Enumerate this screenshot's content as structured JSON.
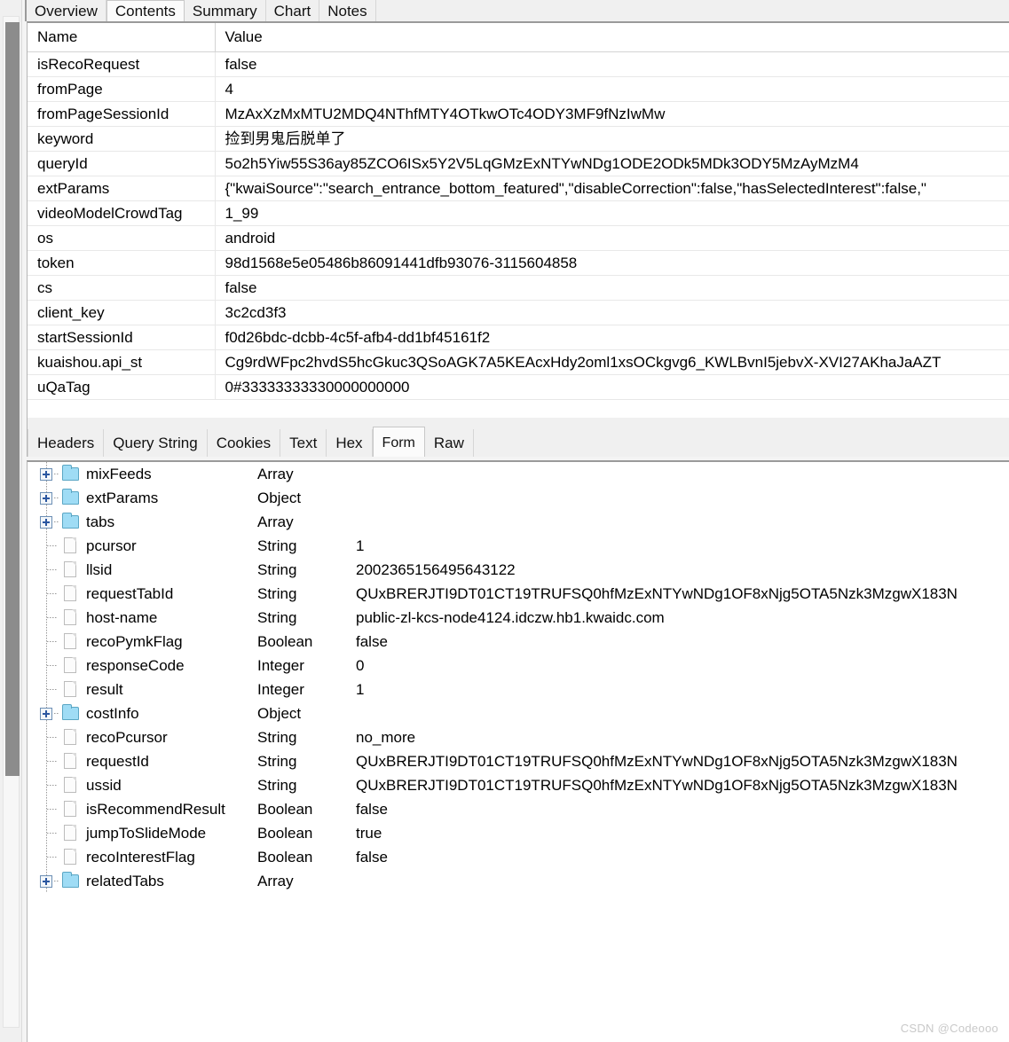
{
  "window": {
    "watermark": "CSDN @Codeooo"
  },
  "top_tabs": {
    "items": [
      {
        "label": "Overview",
        "active": false
      },
      {
        "label": "Contents",
        "active": true
      },
      {
        "label": "Summary",
        "active": false
      },
      {
        "label": "Chart",
        "active": false
      },
      {
        "label": "Notes",
        "active": false
      }
    ]
  },
  "params_table": {
    "columns": [
      "Name",
      "Value"
    ],
    "rows": [
      {
        "name": "isRecoRequest",
        "value": "false"
      },
      {
        "name": "fromPage",
        "value": "4"
      },
      {
        "name": "fromPageSessionId",
        "value": "MzAxXzMxMTU2MDQ4NThfMTY4OTkwOTc4ODY3MF9fNzIwMw"
      },
      {
        "name": "keyword",
        "value": "捡到男鬼后脱单了"
      },
      {
        "name": "queryId",
        "value": "5o2h5Yiw55S36ay85ZCO6ISx5Y2V5LqGMzExNTYwNDg1ODE2ODk5MDk3ODY5MzAyMzM4"
      },
      {
        "name": "extParams",
        "value": "{\"kwaiSource\":\"search_entrance_bottom_featured\",\"disableCorrection\":false,\"hasSelectedInterest\":false,\""
      },
      {
        "name": "videoModelCrowdTag",
        "value": "1_99"
      },
      {
        "name": "os",
        "value": "android"
      },
      {
        "name": "token",
        "value": "98d1568e5e05486b86091441dfb93076-3115604858"
      },
      {
        "name": "cs",
        "value": "false"
      },
      {
        "name": "client_key",
        "value": "3c2cd3f3"
      },
      {
        "name": "startSessionId",
        "value": "f0d26bdc-dcbb-4c5f-afb4-dd1bf45161f2"
      },
      {
        "name": "kuaishou.api_st",
        "value": "Cg9rdWFpc2hvdS5hcGkuc3QSoAGK7A5KEAcxHdy2oml1xsOCkgvg6_KWLBvnI5jebvX-XVI27AKhaJaAZT"
      },
      {
        "name": "uQaTag",
        "value": "0#33333333330000000000"
      }
    ]
  },
  "mid_tabs": {
    "items": [
      {
        "label": "Headers",
        "active": false
      },
      {
        "label": "Query String",
        "active": false
      },
      {
        "label": "Cookies",
        "active": false
      },
      {
        "label": "Text",
        "active": false
      },
      {
        "label": "Hex",
        "active": false
      },
      {
        "label": "Form",
        "active": true
      },
      {
        "label": "Raw",
        "active": false
      }
    ]
  },
  "tree": {
    "rows": [
      {
        "name": "mixFeeds",
        "icon": "folder",
        "expandable": true,
        "type": "Array",
        "value": ""
      },
      {
        "name": "extParams",
        "icon": "folder",
        "expandable": true,
        "type": "Object",
        "value": ""
      },
      {
        "name": "tabs",
        "icon": "folder",
        "expandable": true,
        "type": "Array",
        "value": ""
      },
      {
        "name": "pcursor",
        "icon": "document",
        "expandable": false,
        "type": "String",
        "value": "1"
      },
      {
        "name": "llsid",
        "icon": "document",
        "expandable": false,
        "type": "String",
        "value": "2002365156495643122"
      },
      {
        "name": "requestTabId",
        "icon": "document",
        "expandable": false,
        "type": "String",
        "value": "QUxBRERJTI9DT01CT19TRUFSQ0hfMzExNTYwNDg1OF8xNjg5OTA5Nzk3MzgwX183N"
      },
      {
        "name": "host-name",
        "icon": "document",
        "expandable": false,
        "type": "String",
        "value": "public-zl-kcs-node4124.idczw.hb1.kwaidc.com"
      },
      {
        "name": "recoPymkFlag",
        "icon": "document",
        "expandable": false,
        "type": "Boolean",
        "value": "false"
      },
      {
        "name": "responseCode",
        "icon": "document",
        "expandable": false,
        "type": "Integer",
        "value": "0"
      },
      {
        "name": "result",
        "icon": "document",
        "expandable": false,
        "type": "Integer",
        "value": "1"
      },
      {
        "name": "costInfo",
        "icon": "folder",
        "expandable": true,
        "type": "Object",
        "value": ""
      },
      {
        "name": "recoPcursor",
        "icon": "document",
        "expandable": false,
        "type": "String",
        "value": "no_more"
      },
      {
        "name": "requestId",
        "icon": "document",
        "expandable": false,
        "type": "String",
        "value": "QUxBRERJTI9DT01CT19TRUFSQ0hfMzExNTYwNDg1OF8xNjg5OTA5Nzk3MzgwX183N"
      },
      {
        "name": "ussid",
        "icon": "document",
        "expandable": false,
        "type": "String",
        "value": "QUxBRERJTI9DT01CT19TRUFSQ0hfMzExNTYwNDg1OF8xNjg5OTA5Nzk3MzgwX183N"
      },
      {
        "name": "isRecommendResult",
        "icon": "document",
        "expandable": false,
        "type": "Boolean",
        "value": "false"
      },
      {
        "name": "jumpToSlideMode",
        "icon": "document",
        "expandable": false,
        "type": "Boolean",
        "value": "true"
      },
      {
        "name": "recoInterestFlag",
        "icon": "document",
        "expandable": false,
        "type": "Boolean",
        "value": "false"
      },
      {
        "name": "relatedTabs",
        "icon": "folder",
        "expandable": true,
        "type": "Array",
        "value": ""
      }
    ]
  }
}
